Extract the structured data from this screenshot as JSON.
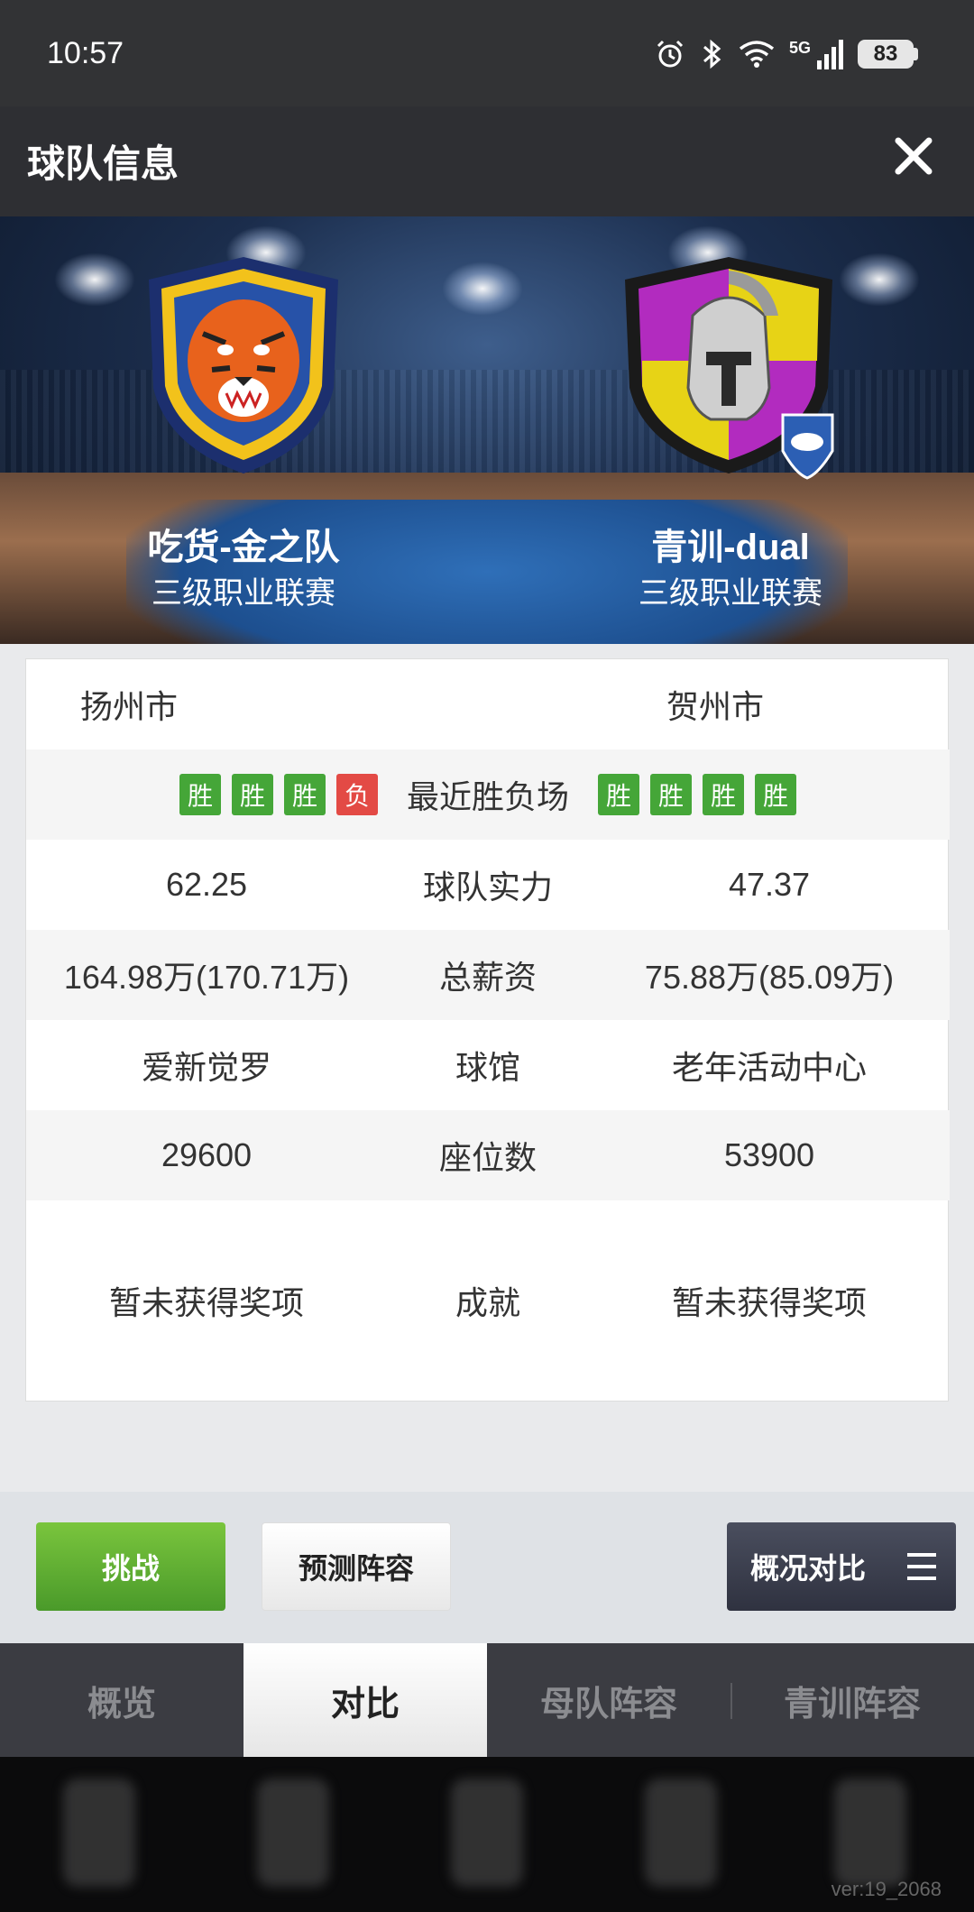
{
  "status_bar": {
    "time": "10:57",
    "battery": "83",
    "network": "5G",
    "icons": [
      "alarm-icon",
      "bluetooth-icon",
      "wifi-icon",
      "signal-icon",
      "battery-icon"
    ]
  },
  "header": {
    "title": "球队信息",
    "close_icon": "close-icon"
  },
  "teams": {
    "left": {
      "name": "吃货-金之队",
      "league": "三级职业联赛",
      "logo": "tiger-crest"
    },
    "right": {
      "name": "青训-dual",
      "league": "三级职业联赛",
      "logo": "spartan-crest"
    }
  },
  "info": {
    "city": {
      "left": "扬州市",
      "right": "贺州市"
    },
    "recent": {
      "label": "最近胜负场",
      "left": [
        "胜",
        "胜",
        "胜",
        "负"
      ],
      "right": [
        "胜",
        "胜",
        "胜",
        "胜"
      ]
    },
    "strength": {
      "label": "球队实力",
      "left": "62.25",
      "right": "47.37"
    },
    "salary": {
      "label": "总薪资",
      "left": "164.98万(170.71万)",
      "right": "75.88万(85.09万)"
    },
    "arena": {
      "label": "球馆",
      "left": "爱新觉罗",
      "right": "老年活动中心"
    },
    "seats": {
      "label": "座位数",
      "left": "29600",
      "right": "53900"
    },
    "achievements": {
      "label": "成就",
      "left": "暂未获得奖项",
      "right": "暂未获得奖项"
    }
  },
  "actions": {
    "challenge": "挑战",
    "predict": "预测阵容",
    "compare": "概况对比"
  },
  "tabs": [
    "概览",
    "对比",
    "母队阵容",
    "青训阵容"
  ],
  "active_tab": "对比",
  "colors": {
    "win": "#45a638",
    "loss": "#e34a45",
    "header_bg": "#2e2f33",
    "challenge_green": "#5aad30"
  },
  "version": "ver:19_2068"
}
